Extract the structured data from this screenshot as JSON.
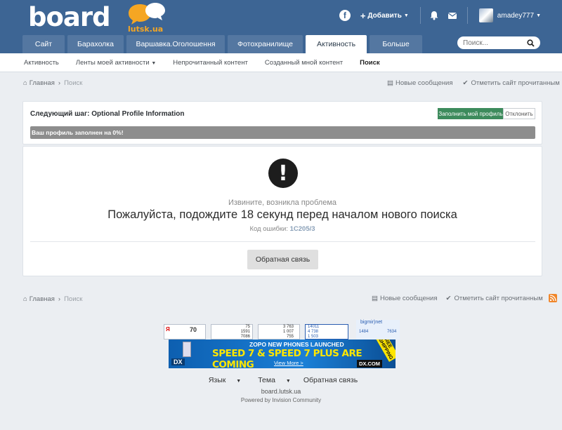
{
  "logo": {
    "main": "board",
    "sub": "lutsk.ua"
  },
  "userbar": {
    "facebook": "f",
    "add_label": "Добавить",
    "username": "amadey777"
  },
  "nav": {
    "tabs": [
      "Сайт",
      "Барахолка",
      "Варшавка.Оголошення",
      "Фотохранилище",
      "Активность",
      "Больше"
    ],
    "active": "Активность",
    "search_placeholder": "Поиск..."
  },
  "subnav": {
    "items": [
      "Активность",
      "Ленты моей активности",
      "Непрочитанный контент",
      "Созданный мной контент",
      "Поиск"
    ]
  },
  "breadcrumb": {
    "home": "Главная",
    "current": "Поиск",
    "new_messages": "Новые сообщения",
    "mark_read": "Отметить сайт прочитанным"
  },
  "profile": {
    "title": "Следующий шаг: Optional Profile Information",
    "fill_button": "Заполнить мой профиль",
    "decline_button": "Отклонить",
    "progress_label": "Ваш профиль заполнен на 0%!",
    "progress_value": 0
  },
  "error": {
    "icon": "!",
    "subtitle": "Извините, возникла проблема",
    "message": "Пожалуйста, подождите 18 секунд перед началом нового поиска",
    "code_label": "Код ошибки:",
    "code": "1C205/3",
    "feedback_button": "Обратная связь"
  },
  "counters": {
    "c1": "70",
    "c2": [
      "75",
      "1591",
      "7086"
    ],
    "c3": [
      "3 763",
      "1 007",
      "755"
    ],
    "c4": [
      "14011",
      "4 738",
      "1 503"
    ],
    "bigmir": {
      "name": "bigmir)net",
      "a": "1484",
      "b": "7634"
    }
  },
  "ad": {
    "top": "ZOPO NEW PHONES LAUNCHED",
    "main": "SPEED 7 & SPEED 7 PLUS ARE COMING",
    "more": "View More >",
    "brand": "DX",
    "site": "DX.COM",
    "ship": "FREE SHIPPING"
  },
  "footer": {
    "language": "Язык",
    "theme": "Тема",
    "contact": "Обратная связь",
    "site": "board.lutsk.ua",
    "powered": "Powered by Invision Community"
  },
  "colors": {
    "header": "#3d6594",
    "accent_green": "#3d8b5c",
    "logo_orange": "#f5a623",
    "rss": "#f0862a"
  }
}
